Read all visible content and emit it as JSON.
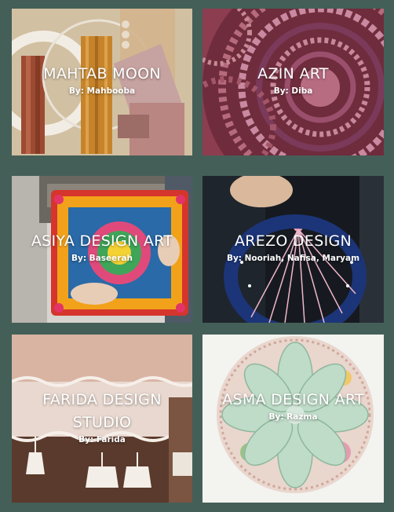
{
  "colors": {
    "page_background": "#445f58",
    "text": "#ffffff"
  },
  "tiles": [
    {
      "title": "MAHTAB MOON",
      "byline": "By: Mahbooba",
      "image": "macrame wall hangings on hoops"
    },
    {
      "title": "AZIN ART",
      "byline": "By: Diba",
      "image": "crochet doily in pink and purple"
    },
    {
      "title": "ASIYA DESIGN ART",
      "byline": "By: Baseerah",
      "image": "embroidered cushion with colorful patterns"
    },
    {
      "title": "AREZO DESIGN",
      "byline": "By: Nooriah, Nafisa, Maryam",
      "image": "blue dreamcatcher with pink strings"
    },
    {
      "title": "FARIDA DESIGN STUDIO",
      "byline": "By: Farida",
      "image": "pink cloth with lace and tassels"
    },
    {
      "title": "ASMA DESIGN ART",
      "byline": "By: Razma",
      "image": "floral fabric flower coaster"
    }
  ]
}
